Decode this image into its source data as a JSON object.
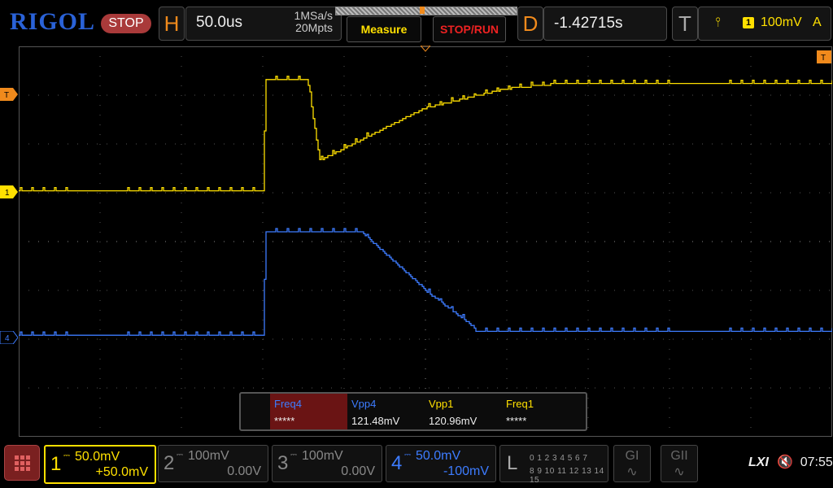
{
  "brand": "RIGOL",
  "run_state": "STOP",
  "horizontal": {
    "letter": "H",
    "timebase": "50.0us",
    "sample_rate": "1MSa/s",
    "memory_depth": "20Mpts"
  },
  "buttons": {
    "measure": "Measure",
    "stop_run": "STOP/RUN"
  },
  "delay": {
    "letter": "D",
    "value": "-1.42715s"
  },
  "trigger": {
    "letter": "T",
    "source": "1",
    "level": "100mV",
    "mode": "A"
  },
  "markers": {
    "trigger_left": "T",
    "trigger_top_right": "T",
    "ch1": "1",
    "ch4": "4"
  },
  "measurements": [
    {
      "name": "Freq4",
      "value": "*****",
      "color": "#3d7cff",
      "highlight": true
    },
    {
      "name": "Vpp4",
      "value": "121.48mV",
      "color": "#3d7cff",
      "highlight": false
    },
    {
      "name": "Vpp1",
      "value": "120.96mV",
      "color": "#ffe000",
      "highlight": false
    },
    {
      "name": "Freq1",
      "value": "*****",
      "color": "#ffe000",
      "highlight": false
    }
  ],
  "channels": [
    {
      "num": "1",
      "scale": "50.0mV",
      "offset": "+50.0mV",
      "color": "#ffe000",
      "active": true
    },
    {
      "num": "2",
      "scale": "100mV",
      "offset": "0.00V",
      "color": "#888888",
      "active": false
    },
    {
      "num": "3",
      "scale": "100mV",
      "offset": "0.00V",
      "color": "#888888",
      "active": false
    },
    {
      "num": "4",
      "scale": "50.0mV",
      "offset": "-100mV",
      "color": "#3d7cff",
      "active": true
    }
  ],
  "logic": {
    "label": "L",
    "row1": "0 1 2 3  4 5 6 7",
    "row2": "8 9 10 11 12 13 14 15"
  },
  "generators": [
    "GI",
    "GII"
  ],
  "status": {
    "lxi": "LXI",
    "time": "07:55"
  },
  "colors": {
    "ch1": "#ffe000",
    "ch4": "#3d7cff",
    "accent": "#f08a1c",
    "grid": "#555555"
  }
}
